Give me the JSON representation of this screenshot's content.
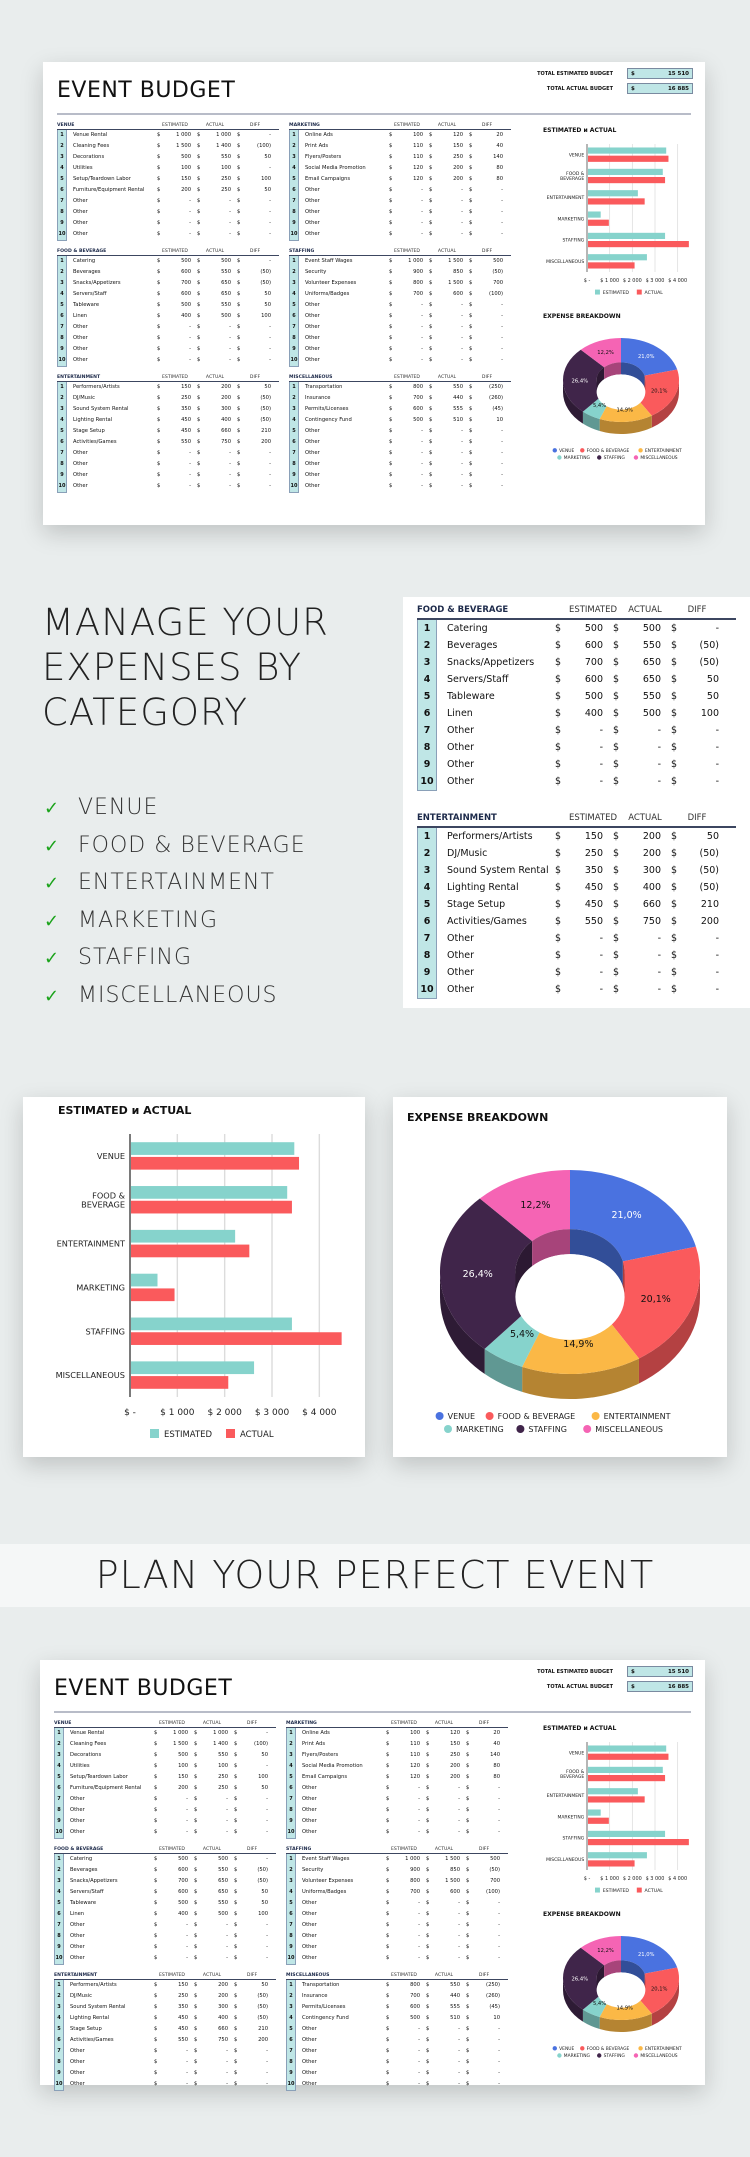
{
  "sheet": {
    "title": "EVENT BUDGET",
    "total_estimated_label": "TOTAL ESTIMATED BUDGET",
    "total_estimated_value": "15 510",
    "total_actual_label": "TOTAL ACTUAL BUDGET",
    "total_actual_value": "16 885",
    "currency": "$",
    "col_estimated": "ESTIMATED",
    "col_actual": "ACTUAL",
    "col_diff": "DIFF",
    "tables": [
      {
        "category": "VENUE",
        "rows": [
          {
            "n": "1",
            "item": "Venue Rental",
            "est": "1 000",
            "act": "1 000",
            "diff": "-"
          },
          {
            "n": "2",
            "item": "Cleaning Fees",
            "est": "1 500",
            "act": "1 400",
            "diff": "(100)"
          },
          {
            "n": "3",
            "item": "Decorations",
            "est": "500",
            "act": "550",
            "diff": "50"
          },
          {
            "n": "4",
            "item": "Utilities",
            "est": "100",
            "act": "100",
            "diff": "-"
          },
          {
            "n": "5",
            "item": "Setup/Teardown Labor",
            "est": "150",
            "act": "250",
            "diff": "100"
          },
          {
            "n": "6",
            "item": "Furniture/Equipment Rental",
            "est": "200",
            "act": "250",
            "diff": "50"
          },
          {
            "n": "7",
            "item": "Other",
            "est": "-",
            "act": "-",
            "diff": "-"
          },
          {
            "n": "8",
            "item": "Other",
            "est": "-",
            "act": "-",
            "diff": "-"
          },
          {
            "n": "9",
            "item": "Other",
            "est": "-",
            "act": "-",
            "diff": "-"
          },
          {
            "n": "10",
            "item": "Other",
            "est": "-",
            "act": "-",
            "diff": "-"
          }
        ]
      },
      {
        "category": "MARKETING",
        "rows": [
          {
            "n": "1",
            "item": "Online Ads",
            "est": "100",
            "act": "120",
            "diff": "20"
          },
          {
            "n": "2",
            "item": "Print Ads",
            "est": "110",
            "act": "150",
            "diff": "40"
          },
          {
            "n": "3",
            "item": "Flyers/Posters",
            "est": "110",
            "act": "250",
            "diff": "140"
          },
          {
            "n": "4",
            "item": "Social Media Promotion",
            "est": "120",
            "act": "200",
            "diff": "80"
          },
          {
            "n": "5",
            "item": "Email Campaigns",
            "est": "120",
            "act": "200",
            "diff": "80"
          },
          {
            "n": "6",
            "item": "Other",
            "est": "-",
            "act": "-",
            "diff": "-"
          },
          {
            "n": "7",
            "item": "Other",
            "est": "-",
            "act": "-",
            "diff": "-"
          },
          {
            "n": "8",
            "item": "Other",
            "est": "-",
            "act": "-",
            "diff": "-"
          },
          {
            "n": "9",
            "item": "Other",
            "est": "-",
            "act": "-",
            "diff": "-"
          },
          {
            "n": "10",
            "item": "Other",
            "est": "-",
            "act": "-",
            "diff": "-"
          }
        ]
      },
      {
        "category": "FOOD & BEVERAGE",
        "rows": [
          {
            "n": "1",
            "item": "Catering",
            "est": "500",
            "act": "500",
            "diff": "-"
          },
          {
            "n": "2",
            "item": "Beverages",
            "est": "600",
            "act": "550",
            "diff": "(50)"
          },
          {
            "n": "3",
            "item": "Snacks/Appetizers",
            "est": "700",
            "act": "650",
            "diff": "(50)"
          },
          {
            "n": "4",
            "item": "Servers/Staff",
            "est": "600",
            "act": "650",
            "diff": "50"
          },
          {
            "n": "5",
            "item": "Tableware",
            "est": "500",
            "act": "550",
            "diff": "50"
          },
          {
            "n": "6",
            "item": "Linen",
            "est": "400",
            "act": "500",
            "diff": "100"
          },
          {
            "n": "7",
            "item": "Other",
            "est": "-",
            "act": "-",
            "diff": "-"
          },
          {
            "n": "8",
            "item": "Other",
            "est": "-",
            "act": "-",
            "diff": "-"
          },
          {
            "n": "9",
            "item": "Other",
            "est": "-",
            "act": "-",
            "diff": "-"
          },
          {
            "n": "10",
            "item": "Other",
            "est": "-",
            "act": "-",
            "diff": "-"
          }
        ]
      },
      {
        "category": "STAFFING",
        "rows": [
          {
            "n": "1",
            "item": "Event Staff Wages",
            "est": "1 000",
            "act": "1 500",
            "diff": "500"
          },
          {
            "n": "2",
            "item": "Security",
            "est": "900",
            "act": "850",
            "diff": "(50)"
          },
          {
            "n": "3",
            "item": "Volunteer Expenses",
            "est": "800",
            "act": "1 500",
            "diff": "700"
          },
          {
            "n": "4",
            "item": "Uniforms/Badges",
            "est": "700",
            "act": "600",
            "diff": "(100)"
          },
          {
            "n": "5",
            "item": "Other",
            "est": "-",
            "act": "-",
            "diff": "-"
          },
          {
            "n": "6",
            "item": "Other",
            "est": "-",
            "act": "-",
            "diff": "-"
          },
          {
            "n": "7",
            "item": "Other",
            "est": "-",
            "act": "-",
            "diff": "-"
          },
          {
            "n": "8",
            "item": "Other",
            "est": "-",
            "act": "-",
            "diff": "-"
          },
          {
            "n": "9",
            "item": "Other",
            "est": "-",
            "act": "-",
            "diff": "-"
          },
          {
            "n": "10",
            "item": "Other",
            "est": "-",
            "act": "-",
            "diff": "-"
          }
        ]
      },
      {
        "category": "ENTERTAINMENT",
        "rows": [
          {
            "n": "1",
            "item": "Performers/Artists",
            "est": "150",
            "act": "200",
            "diff": "50"
          },
          {
            "n": "2",
            "item": "DJ/Music",
            "est": "250",
            "act": "200",
            "diff": "(50)"
          },
          {
            "n": "3",
            "item": "Sound System Rental",
            "est": "350",
            "act": "300",
            "diff": "(50)"
          },
          {
            "n": "4",
            "item": "Lighting Rental",
            "est": "450",
            "act": "400",
            "diff": "(50)"
          },
          {
            "n": "5",
            "item": "Stage Setup",
            "est": "450",
            "act": "660",
            "diff": "210"
          },
          {
            "n": "6",
            "item": "Activities/Games",
            "est": "550",
            "act": "750",
            "diff": "200"
          },
          {
            "n": "7",
            "item": "Other",
            "est": "-",
            "act": "-",
            "diff": "-"
          },
          {
            "n": "8",
            "item": "Other",
            "est": "-",
            "act": "-",
            "diff": "-"
          },
          {
            "n": "9",
            "item": "Other",
            "est": "-",
            "act": "-",
            "diff": "-"
          },
          {
            "n": "10",
            "item": "Other",
            "est": "-",
            "act": "-",
            "diff": "-"
          }
        ]
      },
      {
        "category": "MISCELLANEOUS",
        "rows": [
          {
            "n": "1",
            "item": "Transportation",
            "est": "800",
            "act": "550",
            "diff": "(250)"
          },
          {
            "n": "2",
            "item": "Insurance",
            "est": "700",
            "act": "440",
            "diff": "(260)"
          },
          {
            "n": "3",
            "item": "Permits/Licenses",
            "est": "600",
            "act": "555",
            "diff": "(45)"
          },
          {
            "n": "4",
            "item": "Contingency Fund",
            "est": "500",
            "act": "510",
            "diff": "10"
          },
          {
            "n": "5",
            "item": "Other",
            "est": "-",
            "act": "-",
            "diff": "-"
          },
          {
            "n": "6",
            "item": "Other",
            "est": "-",
            "act": "-",
            "diff": "-"
          },
          {
            "n": "7",
            "item": "Other",
            "est": "-",
            "act": "-",
            "diff": "-"
          },
          {
            "n": "8",
            "item": "Other",
            "est": "-",
            "act": "-",
            "diff": "-"
          },
          {
            "n": "9",
            "item": "Other",
            "est": "-",
            "act": "-",
            "diff": "-"
          },
          {
            "n": "10",
            "item": "Other",
            "est": "-",
            "act": "-",
            "diff": "-"
          }
        ]
      }
    ]
  },
  "promo": {
    "headline_lines": [
      "MANAGE YOUR",
      "EXPENSES BY",
      "CATEGORY"
    ],
    "checklist": [
      "VENUE",
      "FOOD & BEVERAGE",
      "ENTERTAINMENT",
      "MARKETING",
      "STAFFING",
      "MISCELLANEOUS"
    ],
    "check_icon": "checkmark-icon",
    "check_color": "#1aa31a",
    "banner": "PLAN YOUR PERFECT EVENT"
  },
  "colors": {
    "estimated": "#86d3cc",
    "actual": "#fa5a5c",
    "venue": "#4a72e0",
    "food_beverage": "#fa5a5c",
    "entertainment": "#fbb846",
    "marketing": "#86d3cc",
    "staffing": "#40254a",
    "miscellaneous": "#f564b4",
    "number_column": "#bfe6e6",
    "header_rule": "#3c4660"
  },
  "chart_data": [
    {
      "type": "bar",
      "title": "ESTIMATED и ACTUAL",
      "orientation": "horizontal",
      "categories": [
        "VENUE",
        "FOOD & BEVERAGE",
        "ENTERTAINMENT",
        "MARKETING",
        "STAFFING",
        "MISCELLANEOUS"
      ],
      "category_labels": [
        [
          "VENUE"
        ],
        [
          "FOOD &",
          "BEVERAGE"
        ],
        [
          "ENTERTAINMENT"
        ],
        [
          "MARKETING"
        ],
        [
          "STAFFING"
        ],
        [
          "MISCELLANEOUS"
        ]
      ],
      "series": [
        {
          "name": "ESTIMATED",
          "values": [
            3450,
            3300,
            2200,
            560,
            3400,
            2600
          ]
        },
        {
          "name": "ACTUAL",
          "values": [
            3550,
            3400,
            2500,
            920,
            4450,
            2055
          ]
        }
      ],
      "xlim": [
        0,
        4500
      ],
      "xticks": [
        0,
        1000,
        2000,
        3000,
        4000
      ],
      "xtick_labels": [
        "$ -",
        "$ 1 000",
        "$ 2 000",
        "$ 3 000",
        "$ 4 000"
      ],
      "grid": true,
      "legend": "bottom"
    },
    {
      "type": "pie",
      "variant": "3d-donut",
      "title": "EXPENSE BREAKDOWN",
      "labels": [
        "VENUE",
        "FOOD & BEVERAGE",
        "ENTERTAINMENT",
        "MARKETING",
        "STAFFING",
        "MISCELLANEOUS"
      ],
      "values": [
        21.0,
        20.1,
        14.9,
        5.4,
        26.4,
        12.2
      ],
      "value_labels": [
        "21,0%",
        "20,1%",
        "14,9%",
        "5,4%",
        "26,4%",
        "12,2%"
      ],
      "legend": "bottom"
    }
  ]
}
